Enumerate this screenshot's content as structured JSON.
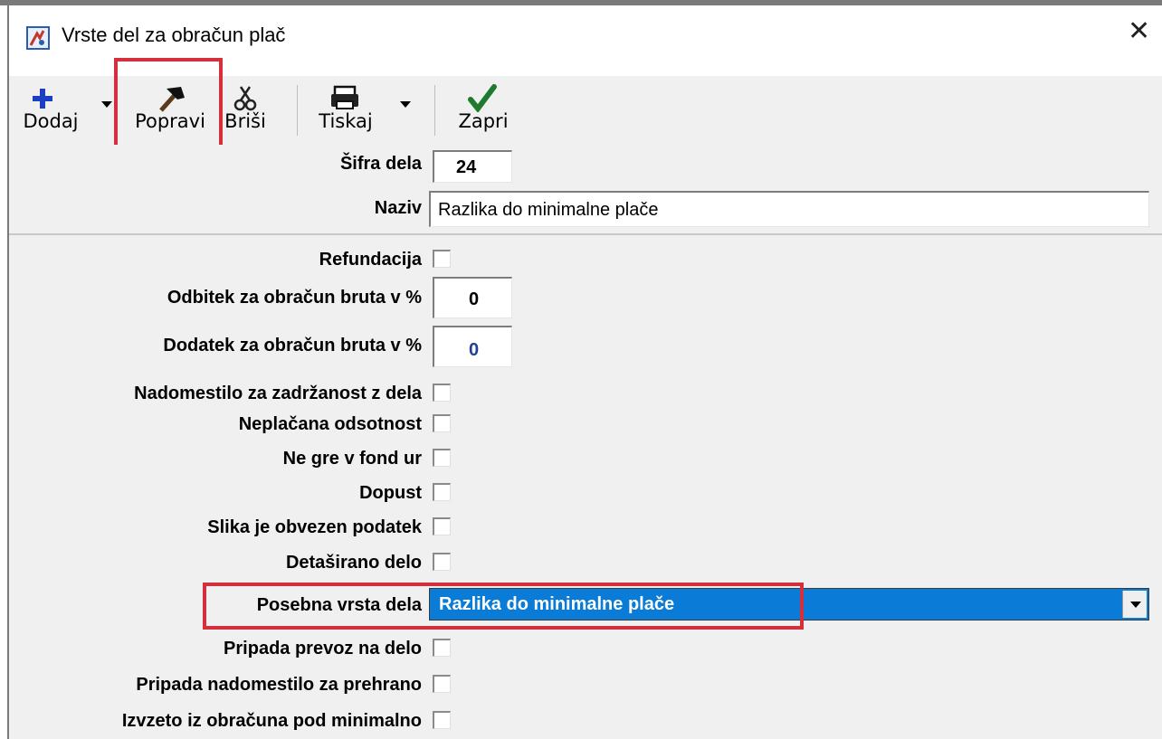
{
  "window": {
    "title": "Vrste del za obračun plač"
  },
  "toolbar": {
    "add_label": "Dodaj",
    "edit_label": "Popravi",
    "delete_label": "Briši",
    "print_label": "Tiskaj",
    "close_label": "Zapri"
  },
  "header_fields": {
    "code_label": "Šifra dela",
    "code_value": "24",
    "name_label": "Naziv",
    "name_value": "Razlika do minimalne plače"
  },
  "fields": {
    "refund_label": "Refundacija",
    "deduction_label": "Odbitek za obračun bruta v %",
    "deduction_value": "0",
    "addition_label": "Dodatek za obračun bruta v %",
    "addition_value": "0",
    "compensation_label": "Nadomestilo za zadržanost z dela",
    "unpaid_label": "Neplačana odsotnost",
    "not_in_fund_label": "Ne gre v fond ur",
    "leave_label": "Dopust",
    "image_required_label": "Slika je obvezen podatek",
    "posted_label": "Detaširano delo",
    "special_type_label": "Posebna vrsta dela",
    "special_type_value": "Razlika do minimalne plače",
    "transport_label": "Pripada prevoz na delo",
    "meal_label": "Pripada nadomestilo za prehrano",
    "excluded_label": "Izvzeto iz obračuna pod minimalno"
  },
  "colors": {
    "highlight": "#d42f3a",
    "selection": "#0a7bd6",
    "value_blue": "#1f3f99"
  }
}
